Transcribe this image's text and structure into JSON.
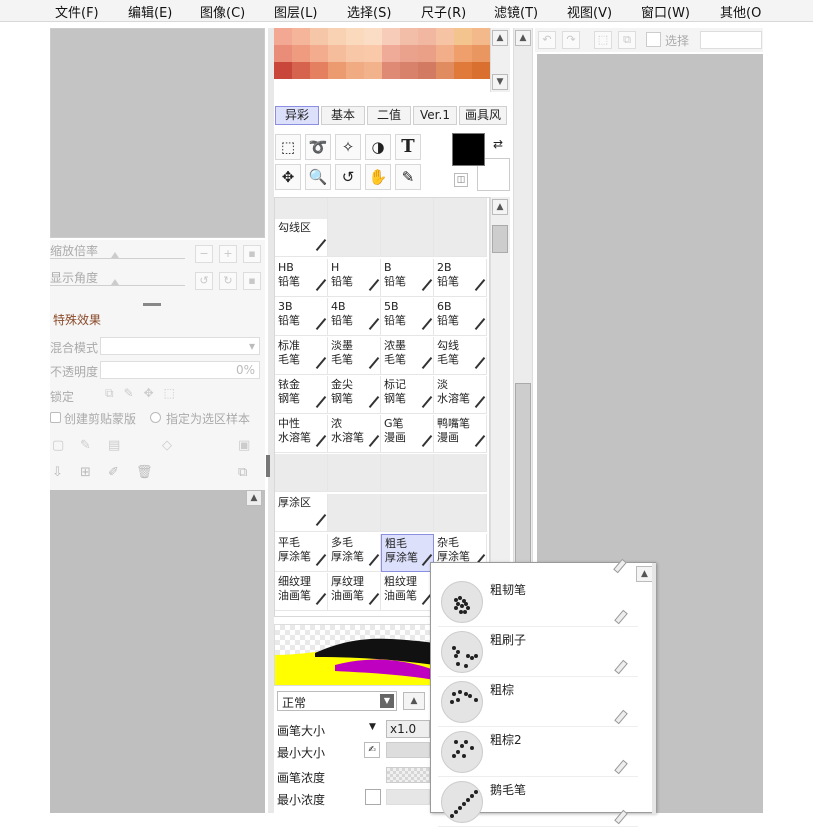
{
  "menubar": {
    "items": [
      "文件(F)",
      "编辑(E)",
      "图像(C)",
      "图层(L)",
      "选择(S)",
      "尺子(R)",
      "滤镜(T)",
      "视图(V)",
      "窗口(W)",
      "其他(O"
    ]
  },
  "left_panel": {
    "zoom_label": "缩放倍率",
    "angle_label": "显示角度",
    "effects_title": "特殊效果",
    "blend_label": "混合模式",
    "opacity_label": "不透明度",
    "opacity_value": "0%",
    "protect_label": "锁定",
    "clip_label": "创建剪贴蒙版",
    "sample_label": "指定为选区样本"
  },
  "colors": {
    "accent_tab": "#dde0fb",
    "accent_border": "#8c8ee0",
    "fg_color": "#000000",
    "bg_color": "#ffffff",
    "canvas_gray": "#c2c2c2"
  },
  "tabs": [
    "异彩",
    "基本",
    "二值",
    "Ver.1",
    "画具风"
  ],
  "tools": [
    "rect-select-icon",
    "lasso-icon",
    "magic-wand-icon",
    "shape-icon",
    "text-icon",
    "move-icon",
    "zoom-icon",
    "rotate-icon",
    "hand-icon",
    "eyedropper-icon"
  ],
  "tool_glyphs": [
    "⬚",
    "➰",
    "✧",
    "◑",
    "T",
    "✥",
    "🔍",
    "↺",
    "✋",
    "✎"
  ],
  "brush_groups": {
    "line_group": "勾线区",
    "thick_group": "厚涂区"
  },
  "brushes": [
    [
      "HB",
      "铅笔"
    ],
    [
      "H",
      "铅笔"
    ],
    [
      "B",
      "铅笔"
    ],
    [
      "2B",
      "铅笔"
    ],
    [
      "3B",
      "铅笔"
    ],
    [
      "4B",
      "铅笔"
    ],
    [
      "5B",
      "铅笔"
    ],
    [
      "6B",
      "铅笔"
    ],
    [
      "标准",
      "毛笔"
    ],
    [
      "淡墨",
      "毛笔"
    ],
    [
      "浓墨",
      "毛笔"
    ],
    [
      "勾线",
      "毛笔"
    ],
    [
      "铱金",
      "钢笔"
    ],
    [
      "金尖",
      "钢笔"
    ],
    [
      "标记",
      "钢笔"
    ],
    [
      "淡",
      "水溶笔"
    ],
    [
      "中性",
      "水溶笔"
    ],
    [
      "浓",
      "水溶笔"
    ],
    [
      "G笔",
      "漫画"
    ],
    [
      "鸭嘴笔",
      "漫画"
    ]
  ],
  "thick_brushes": [
    [
      "平毛",
      "厚涂笔"
    ],
    [
      "多毛",
      "厚涂笔"
    ],
    [
      "粗毛",
      "厚涂笔"
    ],
    [
      "杂毛",
      "厚涂笔"
    ],
    [
      "细纹理",
      "油画笔"
    ],
    [
      "厚纹理",
      "油画笔"
    ],
    [
      "粗纹理",
      "油画笔"
    ],
    [
      "",
      ""
    ]
  ],
  "brush_props": {
    "blend_mode": "正常",
    "size_label": "画笔大小",
    "size_multiplier": "x1.0",
    "min_size_label": "最小大小",
    "density_label": "画笔浓度",
    "min_density_label": "最小浓度"
  },
  "toolbar_right": {
    "select_label": "选择"
  },
  "popup": {
    "items": [
      "粗韧笔",
      "粗刷子",
      "粗棕",
      "粗棕2",
      "鹅毛笔"
    ]
  }
}
